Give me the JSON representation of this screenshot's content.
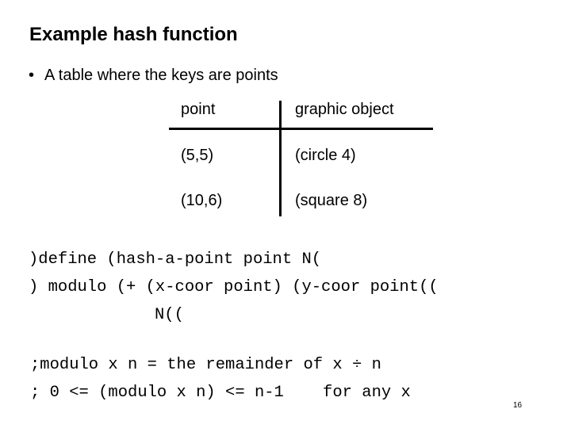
{
  "slide": {
    "title": "Example hash function",
    "bullet_symbol": "•",
    "bullet_text": "A table where the keys are points",
    "page_number": "16"
  },
  "table": {
    "headers": [
      "point",
      "graphic object"
    ],
    "rows": [
      [
        "(5,5)",
        "(circle 4)"
      ],
      [
        "(10,6)",
        "(square 8)"
      ]
    ]
  },
  "code": {
    "lines": [
      ")define (hash-a-point point N(",
      ") modulo (+ (x-coor point) (y-coor point((",
      "N(("
    ]
  },
  "comments": {
    "lines": [
      ";modulo x n = the remainder of x ÷ n",
      "; 0 <= (modulo x n) <= n-1    for any x"
    ]
  }
}
